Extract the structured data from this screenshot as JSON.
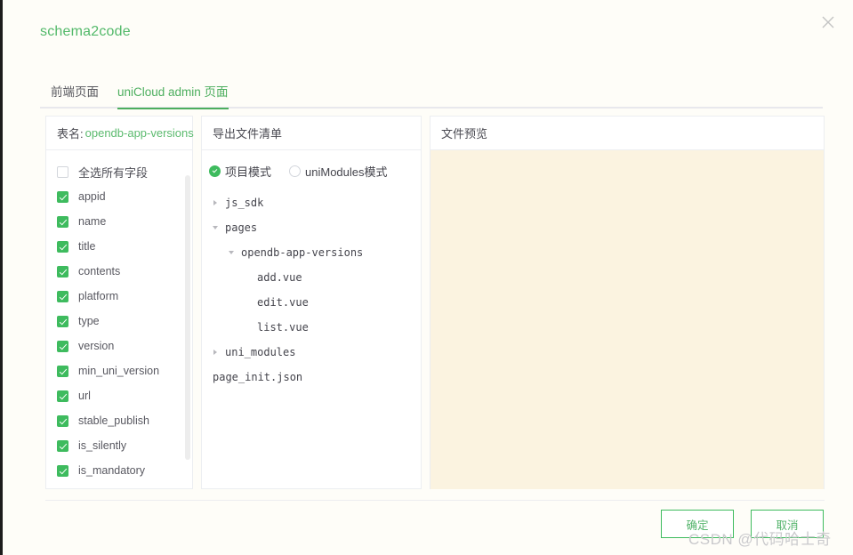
{
  "dialog": {
    "title": "schema2code",
    "close_icon": "close-icon"
  },
  "tabs": [
    {
      "label": "前端页面",
      "active": false
    },
    {
      "label": "uniCloud admin 页面",
      "active": true
    }
  ],
  "fields_panel": {
    "header_prefix": "表名:",
    "table_name": "opendb-app-versions",
    "select_all": {
      "label": "全选所有字段",
      "checked": false
    },
    "fields": [
      {
        "label": "appid",
        "checked": true
      },
      {
        "label": "name",
        "checked": true
      },
      {
        "label": "title",
        "checked": true
      },
      {
        "label": "contents",
        "checked": true
      },
      {
        "label": "platform",
        "checked": true
      },
      {
        "label": "type",
        "checked": true
      },
      {
        "label": "version",
        "checked": true
      },
      {
        "label": "min_uni_version",
        "checked": true
      },
      {
        "label": "url",
        "checked": true
      },
      {
        "label": "stable_publish",
        "checked": true
      },
      {
        "label": "is_silently",
        "checked": true
      },
      {
        "label": "is_mandatory",
        "checked": true
      }
    ]
  },
  "tree_panel": {
    "header": "导出文件清单",
    "modes": [
      {
        "label": "项目模式",
        "selected": true
      },
      {
        "label": "uniModules模式",
        "selected": false
      }
    ],
    "tree": [
      {
        "label": "js_sdk",
        "indent": 0,
        "state": "collapsed"
      },
      {
        "label": "pages",
        "indent": 0,
        "state": "expanded"
      },
      {
        "label": "opendb-app-versions",
        "indent": 1,
        "state": "expanded"
      },
      {
        "label": "add.vue",
        "indent": 2,
        "state": "leaf"
      },
      {
        "label": "edit.vue",
        "indent": 2,
        "state": "leaf"
      },
      {
        "label": "list.vue",
        "indent": 2,
        "state": "leaf"
      },
      {
        "label": "uni_modules",
        "indent": 0,
        "state": "collapsed"
      },
      {
        "label": "page_init.json",
        "indent": -1,
        "state": "leaf"
      }
    ]
  },
  "preview_panel": {
    "header": "文件预览",
    "content": ""
  },
  "footer": {
    "confirm_label": "确定",
    "cancel_label": "取消"
  },
  "watermark": "CSDN @代码哈士奇",
  "colors": {
    "accent_green": "#3ebb5e",
    "title_green": "#53b96a",
    "preview_bg": "#FBF3E0",
    "dialog_bg": "#FEFDF8"
  }
}
